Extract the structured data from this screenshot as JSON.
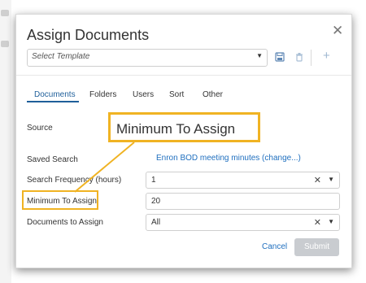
{
  "dialog": {
    "title": "Assign Documents",
    "close_icon": "close-icon"
  },
  "template": {
    "placeholder": "Select Template",
    "icons": [
      "save-icon",
      "trash-icon",
      "plus-icon"
    ]
  },
  "tabs": [
    {
      "label": "Documents",
      "active": true
    },
    {
      "label": "Folders",
      "active": false
    },
    {
      "label": "Users",
      "active": false
    },
    {
      "label": "Sort",
      "active": false
    },
    {
      "label": "Other",
      "active": false
    }
  ],
  "form": {
    "source_label": "Source",
    "saved_search_label": "Saved Search",
    "saved_search_link": "Enron BOD meeting minutes (change...)",
    "search_frequency_label": "Search Frequency (hours)",
    "search_frequency_value": "1",
    "minimum_label": "Minimum To Assign",
    "minimum_value": "20",
    "docs_to_assign_label": "Documents to Assign",
    "docs_to_assign_value": "All"
  },
  "callout": {
    "text": "Minimum To Assign"
  },
  "actions": {
    "cancel_label": "Cancel",
    "submit_label": "Submit"
  },
  "colors": {
    "accent": "#1f5f9a",
    "link": "#1f6fbf",
    "highlight": "#f0b323",
    "submit_disabled": "#c9ccd0"
  }
}
